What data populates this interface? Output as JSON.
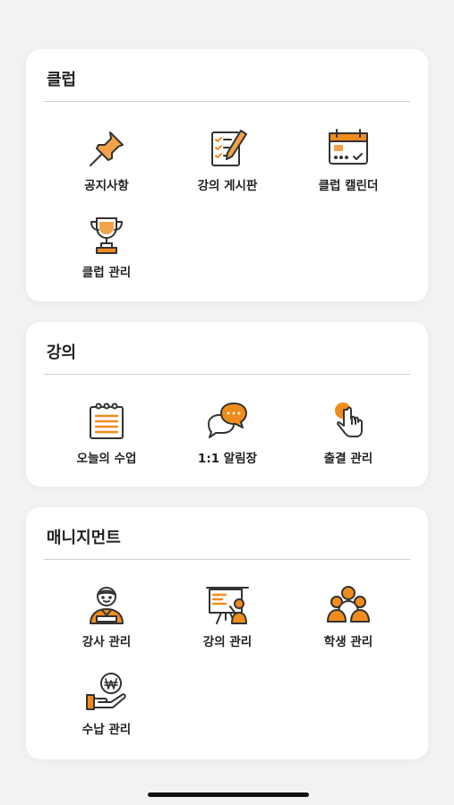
{
  "sections": [
    {
      "title": "클럽",
      "items": [
        {
          "label": "공지사항",
          "icon": "pushpin-icon"
        },
        {
          "label": "강의 게시판",
          "icon": "checklist-pencil-icon"
        },
        {
          "label": "클럽 캘린더",
          "icon": "calendar-icon"
        },
        {
          "label": "클럽 관리",
          "icon": "trophy-icon"
        }
      ]
    },
    {
      "title": "강의",
      "items": [
        {
          "label": "오늘의 수업",
          "icon": "notepad-icon"
        },
        {
          "label": "1:1 알림장",
          "icon": "chat-bubbles-icon"
        },
        {
          "label": "출결 관리",
          "icon": "raised-hand-icon"
        }
      ]
    },
    {
      "title": "매니지먼트",
      "items": [
        {
          "label": "강사 관리",
          "icon": "instructor-icon"
        },
        {
          "label": "강의 관리",
          "icon": "presentation-board-icon"
        },
        {
          "label": "학생 관리",
          "icon": "students-group-icon"
        },
        {
          "label": "수납 관리",
          "icon": "won-payment-icon"
        }
      ]
    }
  ],
  "colors": {
    "accent": "#f08c1e",
    "outline": "#333333",
    "background": "#f1f2f4"
  }
}
